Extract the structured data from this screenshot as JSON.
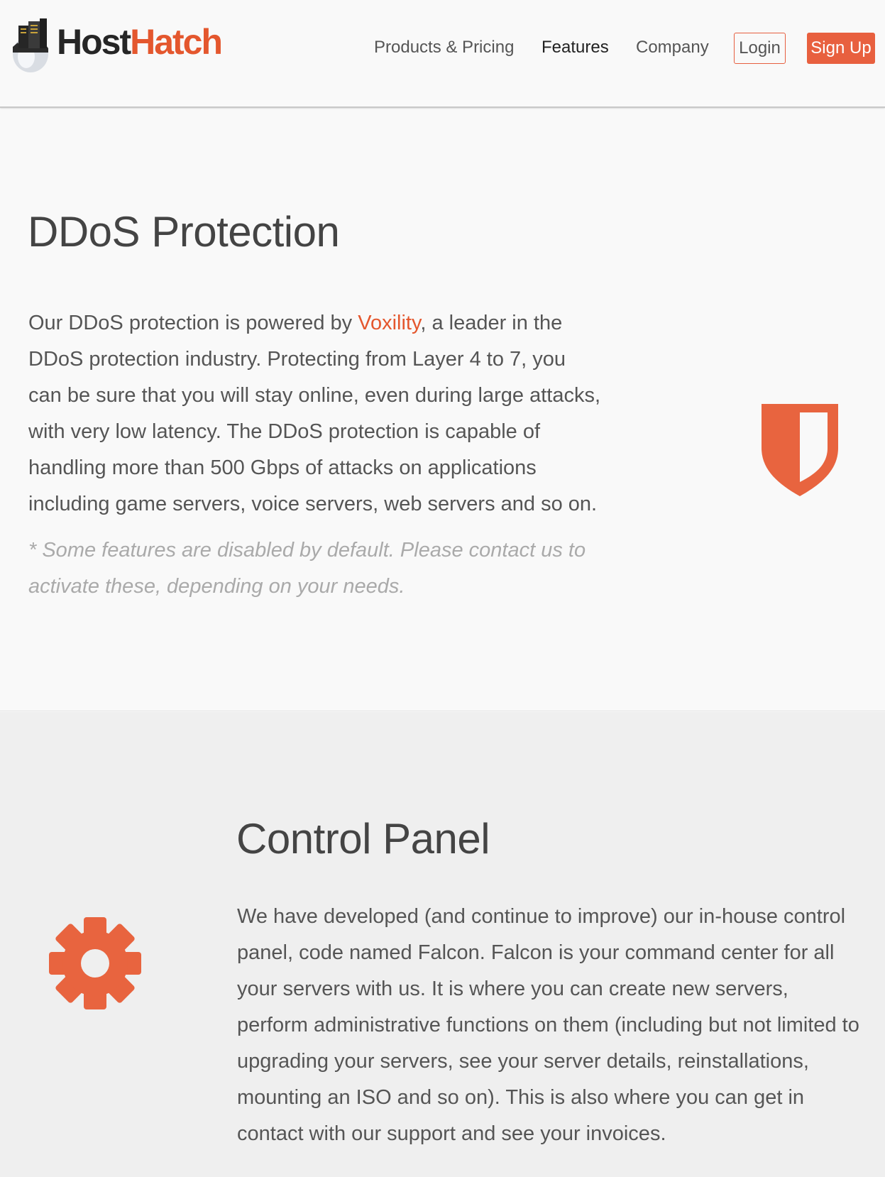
{
  "header": {
    "logo": {
      "part1": "Host",
      "part2": "Hatch"
    },
    "nav": [
      {
        "label": "Products & Pricing"
      },
      {
        "label": "Features"
      },
      {
        "label": "Company"
      }
    ],
    "login_label": "Login",
    "signup_label": "Sign Up"
  },
  "ddos": {
    "title": "DDoS Protection",
    "body_pre": "Our DDoS protection is powered by ",
    "link": "Voxility",
    "body_post": ", a leader in the DDoS protection industry. Protecting from Layer 4 to 7, you can be sure that you will stay online, even during large attacks, with very low latency. The DDoS protection is capable of handling more than 500 Gbps of attacks on applications including game servers, voice servers, web servers and so on.",
    "note": "* Some features are disabled by default. Please contact us to activate these, depending on your needs.",
    "icon": "shield-icon"
  },
  "control_panel": {
    "title": "Control Panel",
    "body": "We have developed (and continue to improve) our in-house control panel, code named Falcon. Falcon is your command center for all your servers with us. It is where you can create new servers, perform administrative functions on them (including but not limited to upgrading your servers, see your server details, reinstallations, mounting an ISO and so on). This is also where you can get in contact with our support and see your invoices.",
    "icon": "gear-icon"
  },
  "colors": {
    "accent": "#e8603f",
    "text": "#555555",
    "muted": "#aaaaaa",
    "background": "#f9f9f9",
    "alt_background": "#efefef"
  }
}
